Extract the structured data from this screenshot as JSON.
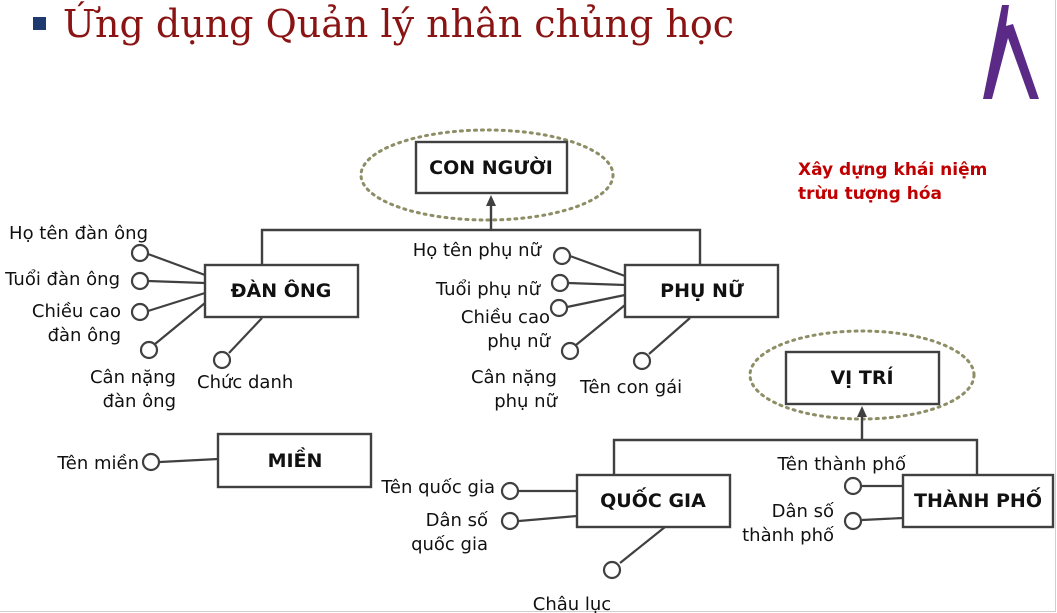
{
  "slide": {
    "title": "Ứng dụng Quản lý nhân chủng học",
    "note": "Xây dựng khái niệm\ntrừu tượng hóa",
    "colors": {
      "title": "#8a1414",
      "note": "#c00000",
      "bullet": "#1f3a6e",
      "logo": "#5b2a86",
      "halo": "#8d8d66"
    }
  },
  "entities": {
    "con_nguoi": "CON NGƯỜI",
    "dan_ong": "ĐÀN ÔNG",
    "phu_nu": "PHỤ NỮ",
    "mien": "MIỀN",
    "vi_tri": "VỊ TRÍ",
    "quoc_gia": "QUỐC GIA",
    "thanh_pho": "THÀNH PHỐ"
  },
  "attributes": {
    "dan_ong": [
      "Họ tên đàn ông",
      "Tuổi đàn ông",
      "Chiều cao\nđàn ông",
      "Cân nặng\nđàn ông",
      "Chức danh"
    ],
    "phu_nu": [
      "Họ tên phụ nữ",
      "Tuổi phụ nữ",
      "Chiều cao\nphụ nữ",
      "Cân nặng\nphụ nữ",
      "Tên con gái"
    ],
    "mien": [
      "Tên miền"
    ],
    "quoc_gia": [
      "Tên quốc gia",
      "Dân số\nquốc gia",
      "Châu lục"
    ],
    "thanh_pho": [
      "Tên thành phố",
      "Dân số\nthành phố"
    ]
  }
}
